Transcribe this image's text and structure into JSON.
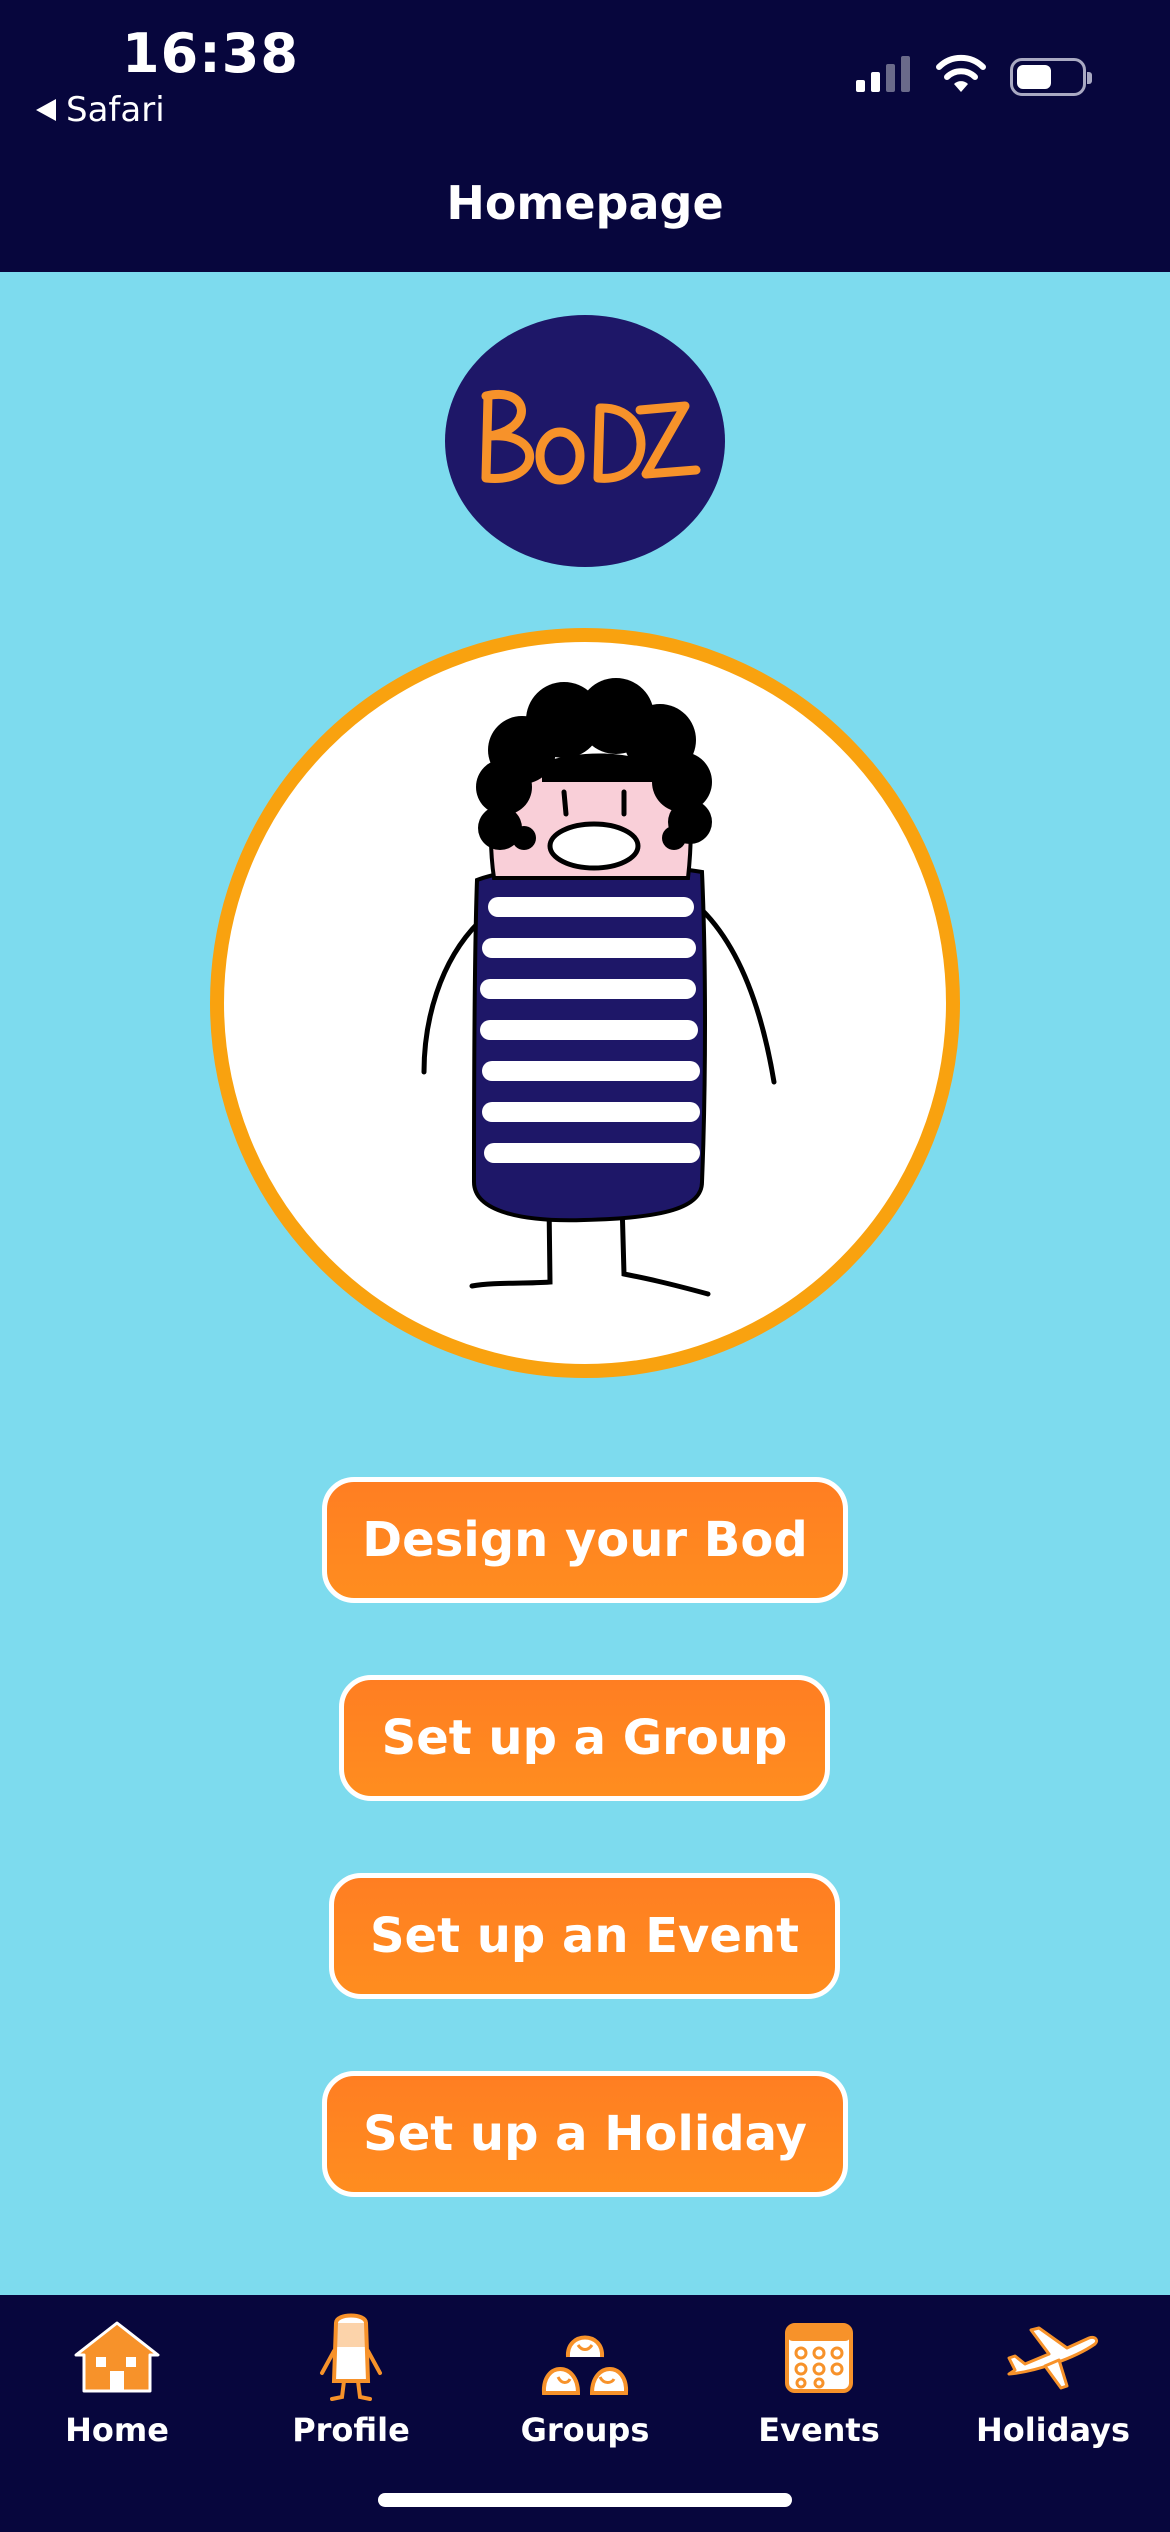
{
  "status_bar": {
    "time": "16:38",
    "back_app": "Safari",
    "signal_bars": 2,
    "signal_bars_total": 4,
    "battery_level": 0.5
  },
  "header": {
    "title": "Homepage"
  },
  "logo": {
    "text": "BODZ",
    "background_color": "#1e1768",
    "text_color": "#f7922a"
  },
  "avatar": {
    "frame_color": "#f9a20f",
    "icon": "bod-character-icon"
  },
  "actions": {
    "design": "Design your Bod",
    "group": "Set up a Group",
    "event": "Set up an Event",
    "holiday": "Set up a Holiday"
  },
  "nav": {
    "items": [
      {
        "label": "Home",
        "icon": "house-icon"
      },
      {
        "label": "Profile",
        "icon": "person-icon"
      },
      {
        "label": "Groups",
        "icon": "group-icon"
      },
      {
        "label": "Events",
        "icon": "calendar-icon"
      },
      {
        "label": "Holidays",
        "icon": "airplane-icon"
      }
    ]
  },
  "colors": {
    "header_bg": "#07063d",
    "page_bg": "#7ddbee",
    "button_bg": "#ff8322",
    "button_border": "#ffffff",
    "nav_icon": "#f7922a"
  }
}
